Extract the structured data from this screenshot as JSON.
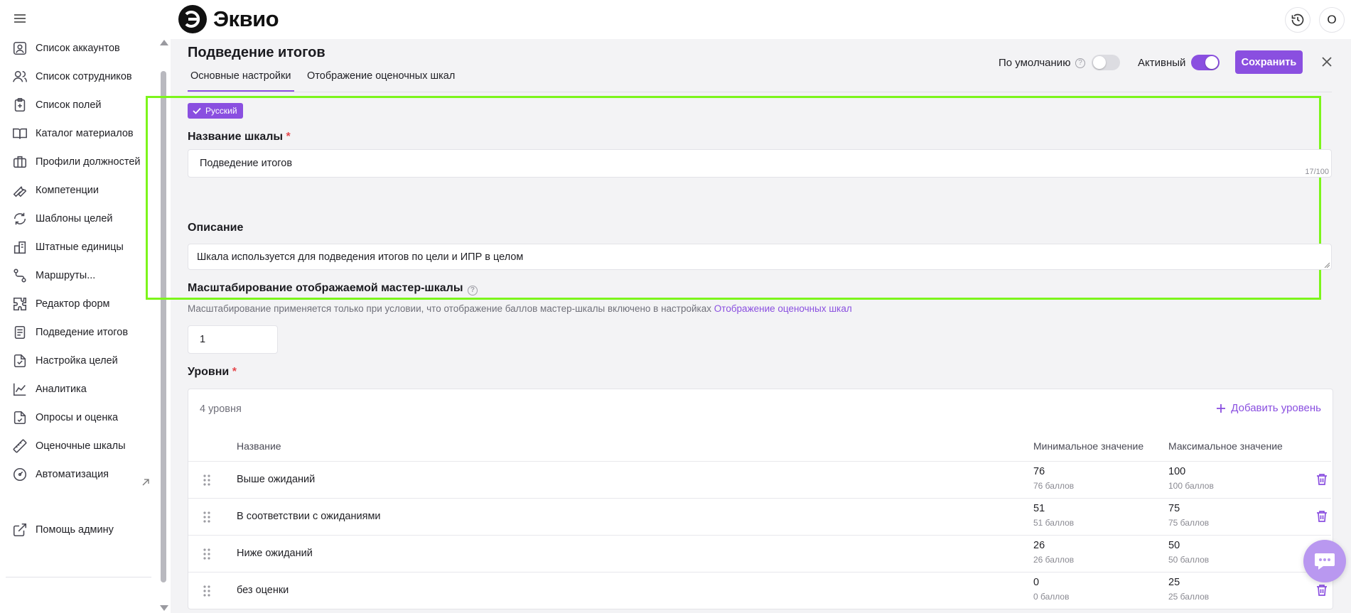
{
  "app": {
    "logo_text": "Эквио",
    "avatar_initial": "O"
  },
  "sidebar": {
    "items": [
      {
        "label": "Список аккаунтов",
        "icon": "user-square-icon"
      },
      {
        "label": "Список сотрудников",
        "icon": "users-icon"
      },
      {
        "label": "Список полей",
        "icon": "clipboard-plus-icon"
      },
      {
        "label": "Каталог материалов",
        "icon": "book-open-icon"
      },
      {
        "label": "Профили должностей",
        "icon": "briefcase-icon"
      },
      {
        "label": "Компетенции",
        "icon": "wrench-icon"
      },
      {
        "label": "Шаблоны целей",
        "icon": "refresh-icon"
      },
      {
        "label": "Штатные единицы",
        "icon": "org-structure-icon"
      },
      {
        "label": "Маршруты...",
        "icon": "route-icon"
      },
      {
        "label": "Редактор форм",
        "icon": "puzzle-icon"
      },
      {
        "label": "Подведение итогов",
        "icon": "document-lines-icon"
      },
      {
        "label": "Настройка целей",
        "icon": "document-check-icon"
      },
      {
        "label": "Аналитика",
        "icon": "chart-line-icon"
      },
      {
        "label": "Опросы и оценка",
        "icon": "survey-icon"
      },
      {
        "label": "Оценочные шкалы",
        "icon": "ruler-icon"
      },
      {
        "label": "Автоматизация",
        "icon": "gauge-icon"
      }
    ],
    "help": {
      "label": "Помощь админу",
      "icon": "external-link-icon"
    }
  },
  "header": {
    "title": "Подведение итогов",
    "default_label": "По умолчанию",
    "default_on": false,
    "active_label": "Активный",
    "active_on": true,
    "save_label": "Сохранить"
  },
  "tabs": [
    {
      "label": "Основные настройки",
      "active": true
    },
    {
      "label": "Отображение оценочных шкал",
      "active": false
    }
  ],
  "form": {
    "language": "Русский",
    "name_label": "Название шкалы",
    "name_value": "Подведение итогов",
    "name_counter": "17/100",
    "desc_label": "Описание",
    "desc_value": "Шкала используется для подведения итогов по цели и ИПР в целом",
    "scale_label": "Масштабирование отображаемой мастер-шкалы",
    "scale_hint": "Масштабирование применяется только при условии, что отображение баллов мастер-шкалы включено в настройках",
    "scale_hint_link": "Отображение оценочных шкал",
    "scale_value": "1"
  },
  "levels": {
    "label": "Уровни",
    "count": "4 уровня",
    "add_label": "Добавить уровень",
    "columns": {
      "name": "Название",
      "min": "Минимальное значение",
      "max": "Максимальное значение"
    },
    "rows": [
      {
        "name": "Выше ожиданий",
        "min": "76",
        "min_sub": "76 баллов",
        "max": "100",
        "max_sub": "100 баллов"
      },
      {
        "name": "В соответствии с ожиданиями",
        "min": "51",
        "min_sub": "51 баллов",
        "max": "75",
        "max_sub": "75 баллов"
      },
      {
        "name": "Ниже ожиданий",
        "min": "26",
        "min_sub": "26 баллов",
        "max": "50",
        "max_sub": "50 баллов"
      },
      {
        "name": "без оценки",
        "min": "0",
        "min_sub": "0 баллов",
        "max": "25",
        "max_sub": "25 баллов"
      }
    ]
  },
  "colors": {
    "accent": "#8a4fe0",
    "highlight": "#7cf51b",
    "danger": "#e5484d"
  }
}
